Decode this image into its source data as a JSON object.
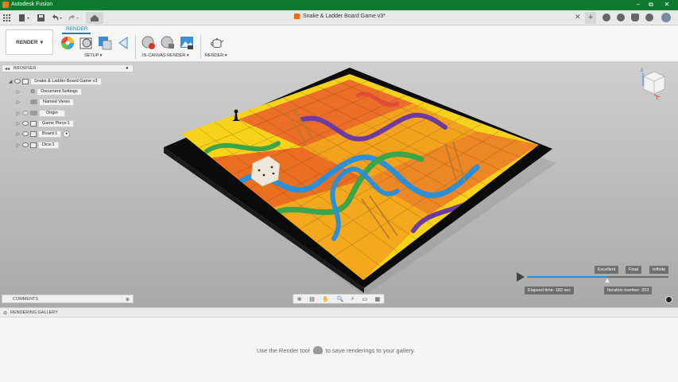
{
  "window": {
    "title": "Autodesk Fusion",
    "controls": [
      "–",
      "⧉",
      "✕"
    ]
  },
  "document_tab": {
    "name": "Snake & Ladder Board Game v3*"
  },
  "workspace": {
    "label": "RENDER",
    "arrow": "▾"
  },
  "ribbon": {
    "active_tab": "RENDER",
    "groups": [
      {
        "label": "SETUP ▾"
      },
      {
        "label": "IN-CANVAS RENDER ▾"
      },
      {
        "label": "RENDER ▾"
      }
    ]
  },
  "browser": {
    "header": "BROWSER",
    "root": "Snake & Ladder Board Game v3",
    "items": [
      {
        "label": "Document Settings",
        "icon": "gear-icon"
      },
      {
        "label": "Named Views",
        "icon": "folder-icon"
      },
      {
        "label": "Origin",
        "icon": "folder-icon"
      },
      {
        "label": "Game Piece:1",
        "icon": "component-icon"
      },
      {
        "label": "Board:1",
        "icon": "component-icon"
      },
      {
        "label": "Dice:1",
        "icon": "component-icon"
      }
    ]
  },
  "comments": {
    "header": "COMMENTS"
  },
  "render_progress": {
    "levels": [
      "Excellent",
      "Final",
      "Infinite"
    ],
    "elapsed": "Elapsed time: 182 sec",
    "iteration": "Iteration number: 203",
    "progress": 0.57
  },
  "viewcube": {
    "axis_z": "Z",
    "axis_x": "X"
  },
  "gallery": {
    "header": "RENDERING GALLERY",
    "hint_before": "Use the Render tool",
    "hint_after": "to save renderings to your gallery."
  },
  "colors": {
    "titlebar": "#0e7a2d",
    "accent": "#1a7fc1",
    "board_frame": "#0b0b0b"
  }
}
